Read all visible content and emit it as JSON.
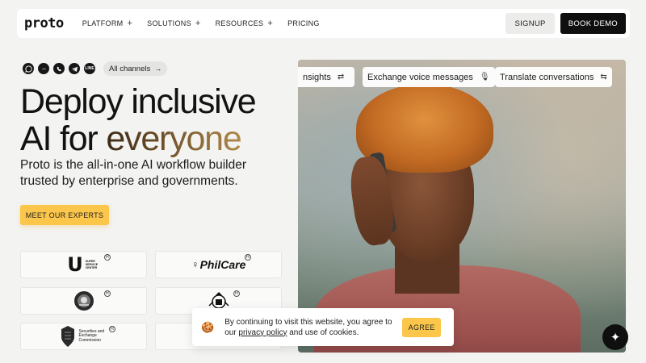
{
  "nav": {
    "logo": "proto",
    "menu": [
      {
        "label": "PLATFORM",
        "has_plus": true
      },
      {
        "label": "SOLUTIONS",
        "has_plus": true
      },
      {
        "label": "RESOURCES",
        "has_plus": true
      },
      {
        "label": "PRICING",
        "has_plus": false
      }
    ],
    "signup": "SIGNUP",
    "book_demo": "BOOK DEMO"
  },
  "channels": {
    "icons": [
      "whatsapp-icon",
      "messenger-icon",
      "viber-icon",
      "telegram-icon",
      "line-icon"
    ],
    "all_label": "All channels"
  },
  "hero": {
    "title_line1": "Deploy inclusive",
    "title_line2_plain": "AI for ",
    "title_line2_accent": "everyone",
    "subtitle": "Proto is the all-in-one AI workflow builder trusted by enterprise and governments.",
    "cta": "MEET OUR EXPERTS"
  },
  "partners": {
    "usc_letter": "U",
    "usc_text": "SUPER SERVICE CENTER",
    "philcare": "PhilCare",
    "sec_text": "Securities and Exchange Commission"
  },
  "photo_chips": [
    {
      "label": "nsights",
      "icon": "transfer-icon"
    },
    {
      "label": "Exchange voice messages",
      "icon": "microphone-icon"
    },
    {
      "label": "Translate conversations",
      "icon": "translate-icon"
    }
  ],
  "cookie": {
    "text_before": "By continuing to visit this website, you agree to our ",
    "link": "privacy policy",
    "text_after": " and use of cookies.",
    "agree": "AGREE"
  },
  "colors": {
    "accent": "#fbc64a",
    "dark": "#0f0f0f",
    "background": "#f3f3f1"
  }
}
